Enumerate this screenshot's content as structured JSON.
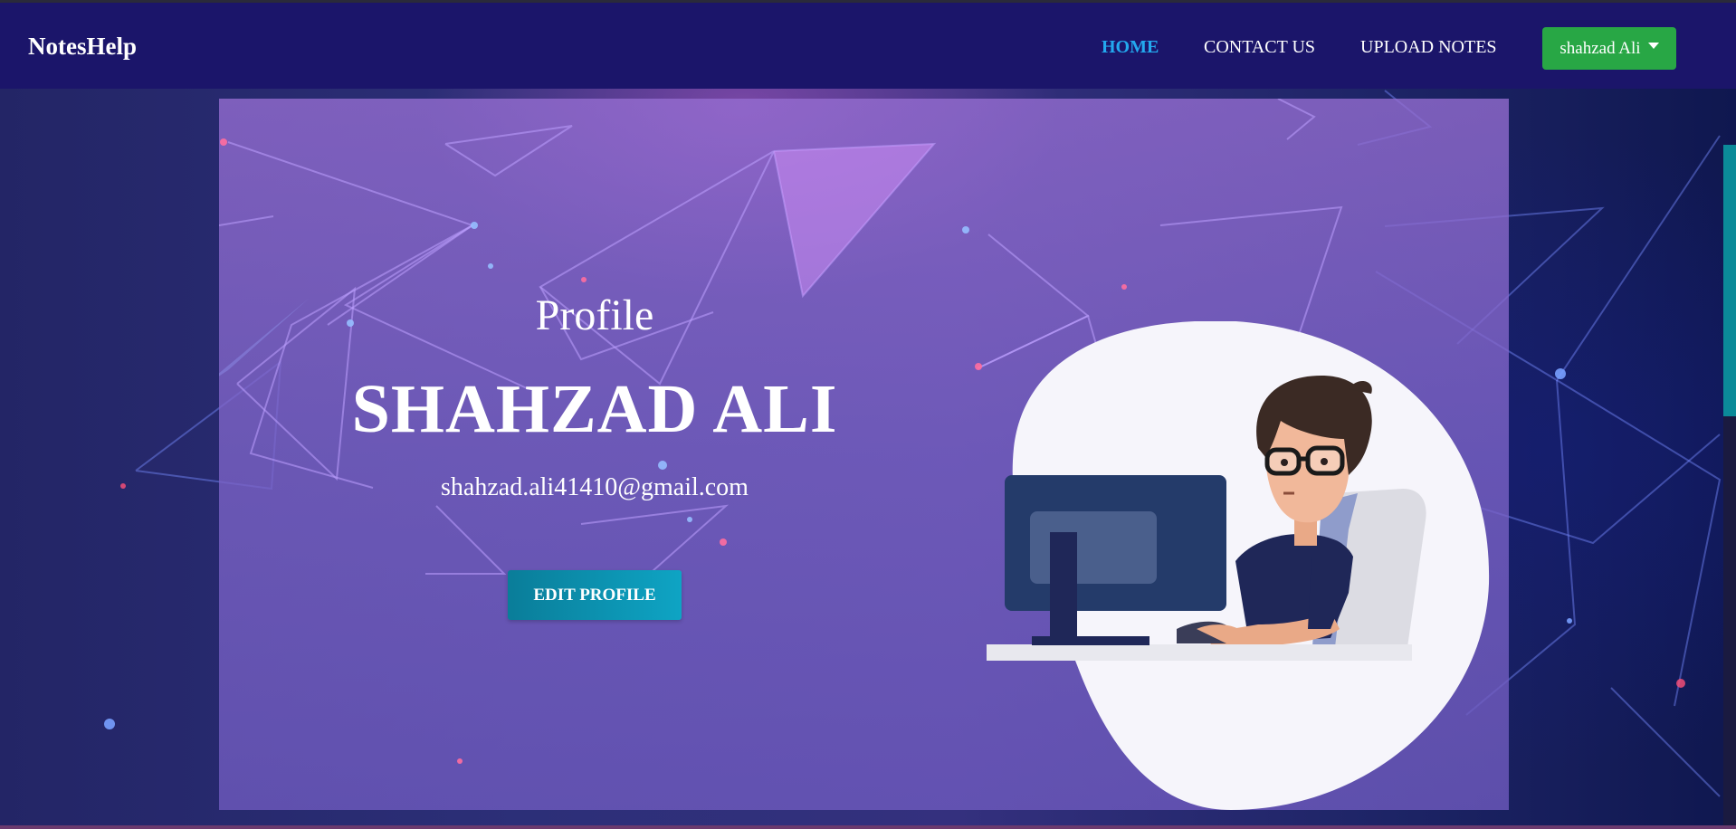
{
  "navbar": {
    "brand": "NotesHelp",
    "links": [
      {
        "label": "HOME",
        "active": true
      },
      {
        "label": "CONTACT US",
        "active": false
      },
      {
        "label": "UPLOAD NOTES",
        "active": false
      }
    ],
    "user_menu": {
      "label": "shahzad Ali"
    }
  },
  "profile": {
    "heading": "Profile",
    "name": "SHAHZAD ALI",
    "email": "shahzad.ali41410@gmail.com",
    "edit_button": "EDIT PROFILE"
  },
  "colors": {
    "navbar_bg": "#1b156a",
    "active_link": "#23a9ef",
    "user_button": "#28a745",
    "edit_button": "#0ea4c4"
  },
  "icons": {
    "dropdown": "caret-down-icon",
    "illustration": "person-at-computer-illustration"
  }
}
